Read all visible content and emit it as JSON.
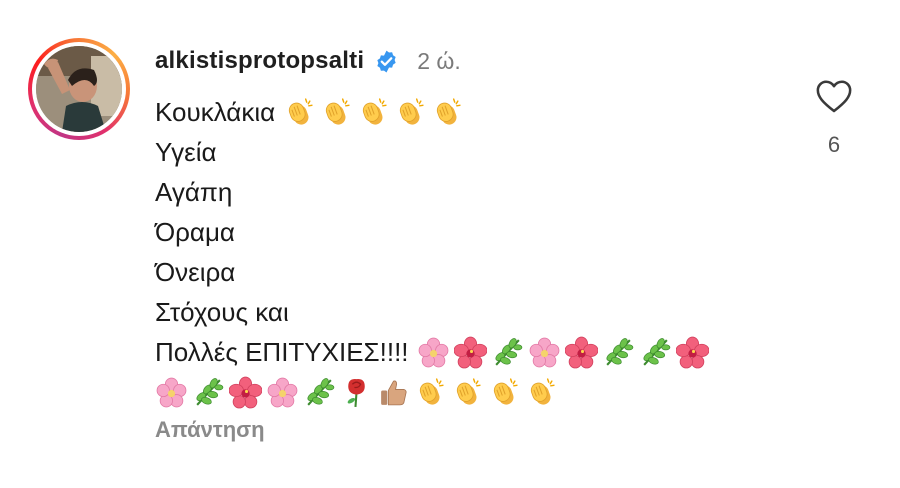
{
  "comment": {
    "username": "alkistisprotopsalti",
    "verified": true,
    "time": "2 ώ.",
    "lines": [
      {
        "text": "Κουκλάκια",
        "emojis": [
          "clap",
          "clap",
          "clap",
          "clap",
          "clap"
        ]
      },
      {
        "text": "Υγεία",
        "emojis": []
      },
      {
        "text": "Αγάπη",
        "emojis": []
      },
      {
        "text": "Όραμα",
        "emojis": []
      },
      {
        "text": "Όνειρα",
        "emojis": []
      },
      {
        "text": "Στόχους και",
        "emojis": []
      },
      {
        "text": "Πολλές ΕΠΙΤΥΧΙΕΣ!!!!",
        "emojis": [
          "cherry-blossom",
          "hibiscus",
          "herb",
          "cherry-blossom",
          "hibiscus",
          "herb",
          "herb",
          "hibiscus"
        ]
      },
      {
        "text": "",
        "emojis": [
          "cherry-blossom",
          "herb",
          "hibiscus",
          "cherry-blossom",
          "herb",
          "rose",
          "thumbs-up",
          "clap",
          "clap",
          "clap",
          "clap"
        ]
      }
    ],
    "reply_label": "Απάντηση",
    "like_count": "6"
  },
  "colors": {
    "verified_blue": "#3897f0",
    "ring_gradient": [
      "#c13584",
      "#e1306c",
      "#fd1d1d",
      "#f77737",
      "#fcaf45"
    ],
    "secondary_text": "#7a7a7a"
  },
  "icons": {
    "like": "heart-outline-icon",
    "verified": "verified-badge-icon"
  }
}
